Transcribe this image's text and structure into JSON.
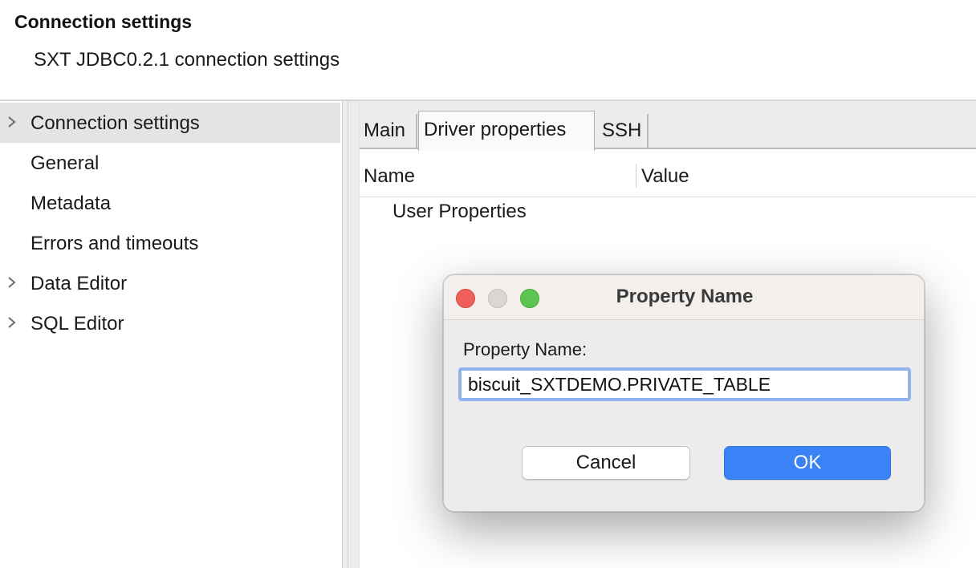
{
  "header": {
    "title": "Connection settings",
    "subtitle": "SXT JDBC0.2.1 connection settings"
  },
  "sidebar": {
    "items": [
      {
        "label": "Connection settings",
        "expandable": true,
        "selected": true
      },
      {
        "label": "General",
        "expandable": false,
        "selected": false
      },
      {
        "label": "Metadata",
        "expandable": false,
        "selected": false
      },
      {
        "label": "Errors and timeouts",
        "expandable": false,
        "selected": false
      },
      {
        "label": "Data Editor",
        "expandable": true,
        "selected": false
      },
      {
        "label": "SQL Editor",
        "expandable": true,
        "selected": false
      }
    ]
  },
  "tabs": [
    {
      "label": "Main",
      "active": false
    },
    {
      "label": "Driver properties",
      "active": true
    },
    {
      "label": "SSH",
      "active": false
    }
  ],
  "table": {
    "columns": [
      "Name",
      "Value"
    ],
    "groups": [
      "User Properties"
    ]
  },
  "dialog": {
    "title": "Property Name",
    "field_label": "Property Name:",
    "field_value": "biscuit_SXTDEMO.PRIVATE_TABLE",
    "cancel_label": "Cancel",
    "ok_label": "OK"
  },
  "colors": {
    "ok_button": "#3b82f6",
    "selected_row": "#e4e4e4",
    "close_button": "#ee5f57",
    "zoom_button": "#5ec450"
  }
}
